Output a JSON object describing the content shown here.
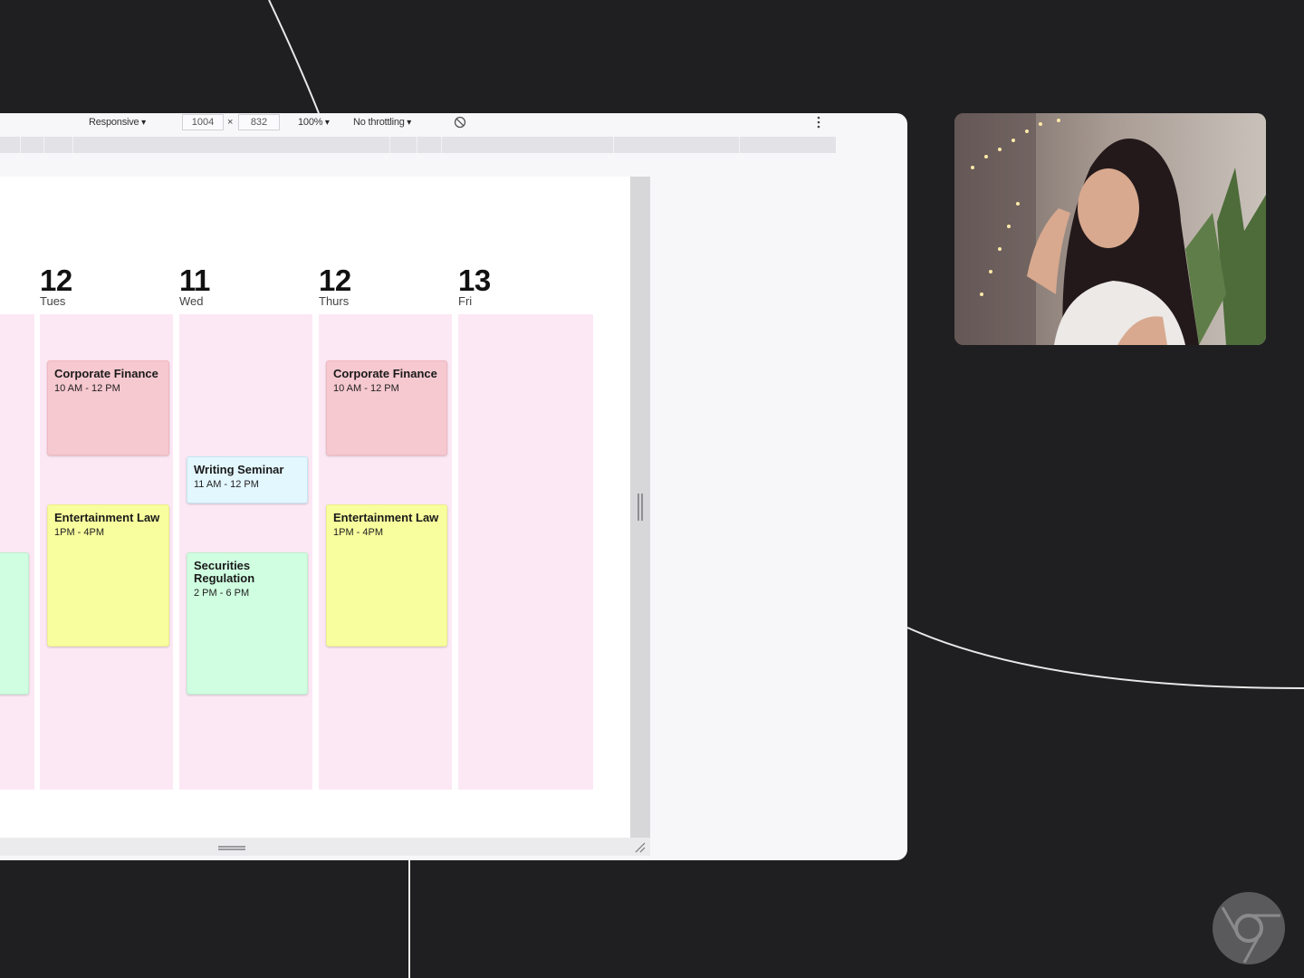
{
  "toolbar": {
    "device_mode": "Responsive",
    "width_value": "1004",
    "times": "×",
    "height_value": "832",
    "zoom": "100%",
    "throttling": "No throttling"
  },
  "calendar": {
    "days": [
      {
        "number": "12",
        "name": "Tues"
      },
      {
        "number": "11",
        "name": "Wed"
      },
      {
        "number": "12",
        "name": "Thurs"
      },
      {
        "number": "13",
        "name": "Fri"
      }
    ],
    "events": {
      "tues_corp": {
        "title": "Corporate Finance",
        "time": "10 AM - 12 PM"
      },
      "tues_ent": {
        "title": "Entertainment Law",
        "time": "1PM - 4PM"
      },
      "wed_writing": {
        "title": "Writing Seminar",
        "time": "11 AM - 12 PM"
      },
      "wed_sec": {
        "title": "Securities Regulation",
        "time": "2 PM - 6 PM"
      },
      "thurs_corp": {
        "title": "Corporate Finance",
        "time": "10 AM - 12 PM"
      },
      "thurs_ent": {
        "title": "Entertainment Law",
        "time": "1PM - 4PM"
      }
    }
  },
  "colors": {
    "column_bg": "#fce8f4",
    "event_red": "#f6c8cf",
    "event_yellow": "#f8fd9d",
    "event_green": "#cffee0",
    "event_blue": "#e3f7ff",
    "page_bg": "#1f1f21"
  },
  "icons": {
    "rotate": "rotate-icon",
    "more": "kebab-menu-icon",
    "logo": "chrome-logo"
  }
}
